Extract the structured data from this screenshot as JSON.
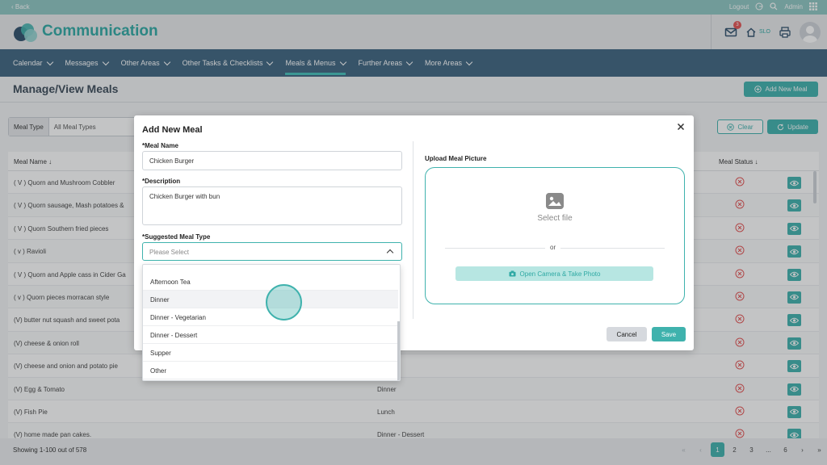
{
  "topbar": {
    "back_label": "‹ Back",
    "logout_label": "Logout",
    "admin_label": "Admin"
  },
  "header": {
    "app_title": "Communication",
    "mail_badge": "3",
    "home_label": "SLO"
  },
  "nav": {
    "items": [
      {
        "label": "Calendar"
      },
      {
        "label": "Messages"
      },
      {
        "label": "Other Areas"
      },
      {
        "label": "Other Tasks & Checklists"
      },
      {
        "label": "Meals & Menus"
      },
      {
        "label": "Further Areas"
      },
      {
        "label": "More Areas"
      }
    ],
    "active_index": 4
  },
  "page": {
    "title": "Manage/View Meals",
    "add_button": "Add New Meal"
  },
  "filter": {
    "label": "Meal Type",
    "value": "All Meal Types",
    "clear_label": "Clear",
    "update_label": "Update"
  },
  "table": {
    "col_name": "Meal Name",
    "col_status": "Meal Status",
    "rows": [
      {
        "name": "( V ) Quorn and Mushroom Cobbler",
        "type": ""
      },
      {
        "name": "( V ) Quorn sausage, Mash potatoes &",
        "type": ""
      },
      {
        "name": "( V ) Quorn Southern fried pieces",
        "type": ""
      },
      {
        "name": "( v ) Ravioli",
        "type": ""
      },
      {
        "name": "( V ) Quorn and Apple cass in Cider Ga",
        "type": ""
      },
      {
        "name": "( v ) Quorn pieces morracan style",
        "type": ""
      },
      {
        "name": "(V) butter nut squash and sweet pota",
        "type": ""
      },
      {
        "name": "(V) cheese & onion roll",
        "type": ""
      },
      {
        "name": "(V) cheese and onion and potato pie",
        "type": ""
      },
      {
        "name": "(V) Egg & Tomato",
        "type": "Dinner"
      },
      {
        "name": "(V) Fish Pie",
        "type": "Lunch"
      },
      {
        "name": "(V) home made pan cakes.",
        "type": "Dinner - Dessert"
      }
    ]
  },
  "footer": {
    "showing": "Showing 1-100 out of 578",
    "pages": [
      "1",
      "2",
      "3",
      "...",
      "6"
    ]
  },
  "modal": {
    "title": "Add New Meal",
    "name_label": "*Meal Name",
    "name_value": "Chicken Burger",
    "desc_label": "*Description",
    "desc_value": "Chicken Burger with bun",
    "type_label": "*Suggested Meal Type",
    "type_placeholder": "Please Select",
    "upload_label": "Upload Meal Picture",
    "select_file": "Select file",
    "or_text": "or",
    "camera_label": "Open Camera & Take Photo",
    "cancel_label": "Cancel",
    "save_label": "Save"
  },
  "dropdown": {
    "options": [
      "Afternoon Tea",
      "Dinner",
      "Dinner - Vegetarian",
      "Dinner - Dessert",
      "Supper",
      "Other"
    ],
    "hover_index": 1
  },
  "colors": {
    "teal": "#3fb2ad",
    "nav": "#3d6480",
    "topstrip": "#8ec6c2"
  }
}
